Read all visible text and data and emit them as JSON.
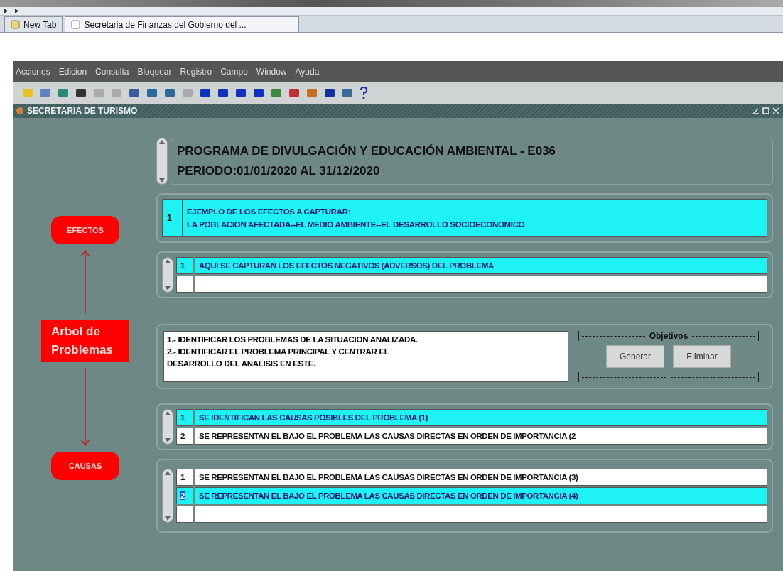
{
  "browser": {
    "tabs": [
      {
        "label": "New Tab",
        "selected": false
      },
      {
        "label": "Secretaria de Finanzas del Gobierno del ...",
        "selected": true
      }
    ]
  },
  "menu": [
    "Acciones",
    "Edicion",
    "Consulta",
    "Bloquear",
    "Registro",
    "Campo",
    "Window",
    "Ayuda"
  ],
  "window": {
    "title": "SECRETARIA DE TURISMO"
  },
  "side": {
    "effects_label": "EFECTOS",
    "tree_label": "Arbol de Problemas",
    "causes_label": "CAUSAS"
  },
  "header": {
    "lines": [
      "PROGRAMA DE DIVULGACIÓN Y EDUCACIÓN AMBIENTAL  - E036",
      "PERIODO:01/01/2020 AL 31/12/2020"
    ]
  },
  "effects_example": {
    "number": "1",
    "lines": [
      "EJEMPLO DE LOS EFECTOS A CAPTURAR:",
      "LA POBLACION AFECTADA--EL MEDIO AMBIENTE--EL DESARROLLO SOCIOECONOMICO"
    ]
  },
  "effects": {
    "rows": [
      {
        "number": "1",
        "text": "AQUI SE CAPTURAN LOS EFECTOS NEGATIVOS (ADVERSOS) DEL PROBLEMA",
        "selected": true
      },
      {
        "selected": false
      }
    ]
  },
  "objectives": {
    "text": [
      "1.- IDENTIFICAR LOS PROBLEMAS DE LA SITUACION ANALIZADA.",
      "2.- IDENTIFICAR EL PROBLEMA PRINCIPAL Y CENTRAR EL",
      "DESARROLLO DEL ANALISIS EN ESTE."
    ],
    "group_label": "Objetivos",
    "buttons": [
      "Generar",
      "Eliminar"
    ]
  },
  "causes": {
    "rows": [
      {
        "number": "1",
        "text": "SE IDENTIFICAN LAS CAUSAS POSIBLES DEL PROBLEMA (1)",
        "selected": true
      },
      {
        "number": "2",
        "text": "SE REPRESENTAN EL BAJO EL PROBLEMA LAS CAUSAS DIRECTAS EN ORDEN DE IMPORTANCIA (2",
        "selected": false
      }
    ]
  },
  "sub_causes": {
    "rows": [
      {
        "number": "1",
        "text": "SE REPRESENTAN EL BAJO EL PROBLEMA LAS CAUSAS DIRECTAS EN ORDEN DE IMPORTANCIA (3)",
        "selected": false
      },
      {
        "number": "2",
        "text": "SE REPRESENTAN EL BAJO EL PROBLEMA LAS CAUSAS DIRECTAS EN ORDEN DE IMPORTANCIA (4)",
        "selected": true
      },
      {
        "selected": false
      }
    ]
  }
}
